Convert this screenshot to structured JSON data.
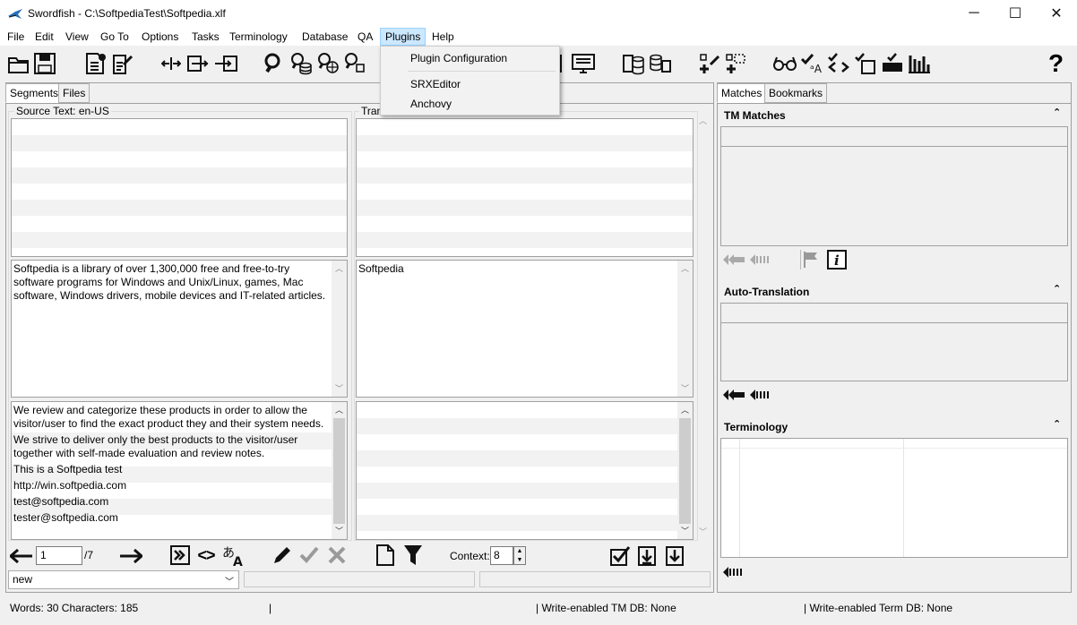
{
  "window": {
    "title": "Swordfish - C:\\SoftpediaTest\\Softpedia.xlf",
    "minimize_glyph": "─",
    "maximize_glyph": "☐",
    "close_glyph": "✕"
  },
  "menu": {
    "items": [
      "File",
      "Edit",
      "View",
      "Go To",
      "Options",
      "Tasks",
      "Terminology",
      "Database",
      "QA",
      "Plugins",
      "Help"
    ],
    "active": "Plugins"
  },
  "plugins_menu": {
    "items": [
      "Plugin Configuration",
      "SRXEditor",
      "Anchovy"
    ]
  },
  "toolbar": {
    "help_glyph": "?"
  },
  "left": {
    "tabs": [
      "Segments",
      "Files"
    ],
    "source_label": "Source Text: en-US",
    "target_label": "Tran",
    "current_source": "Softpedia is a library of over 1,300,000 free and free-to-try software programs for Windows and Unix/Linux, games, Mac software, Windows drivers, mobile devices and IT-related articles.",
    "current_target": "Softpedia",
    "following_segments": [
      "We review and categorize these products in order to allow the visitor/user to find the exact product they and their system needs.",
      "We strive to deliver only the best products to the visitor/user together with self-made evaluation and review notes.",
      "This is a Softpedia test",
      "http://win.softpedia.com",
      "test@softpedia.com",
      "tester@softpedia.com"
    ]
  },
  "nav": {
    "segment_number": "1",
    "segment_total": "/7",
    "tag_glyph": "<>",
    "context_label": "Context:",
    "context_value": "8",
    "status_value": "new"
  },
  "right": {
    "tabs": [
      "Matches",
      "Bookmarks"
    ],
    "tm_title": "TM Matches",
    "auto_title": "Auto-Translation",
    "term_title": "Terminology",
    "collapse_glyph": "⌃"
  },
  "statusbar": {
    "words": "Words: 30 Characters: 185",
    "sep1": "|",
    "tm_db": "| Write-enabled TM DB: None",
    "term_db": "| Write-enabled Term DB: None"
  },
  "colors": {
    "menu_highlight": "#cce8ff",
    "pane_border": "#a0a0a0",
    "icon": "#111111"
  }
}
